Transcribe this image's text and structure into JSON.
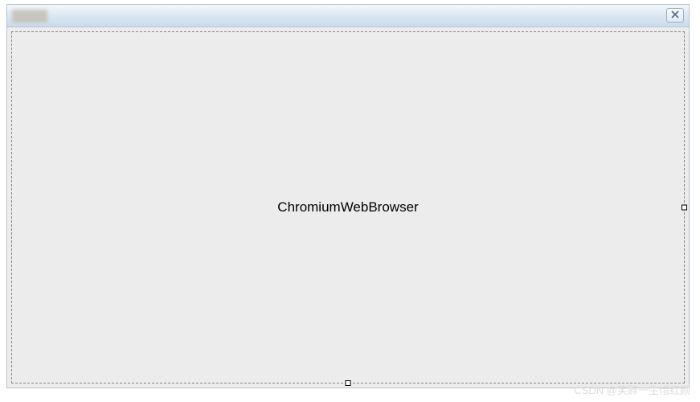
{
  "window": {
    "title": ""
  },
  "content": {
    "component_label": "ChromiumWebBrowser"
  },
  "watermark": {
    "text": "CSDN @笑醉一生惜红颜"
  }
}
